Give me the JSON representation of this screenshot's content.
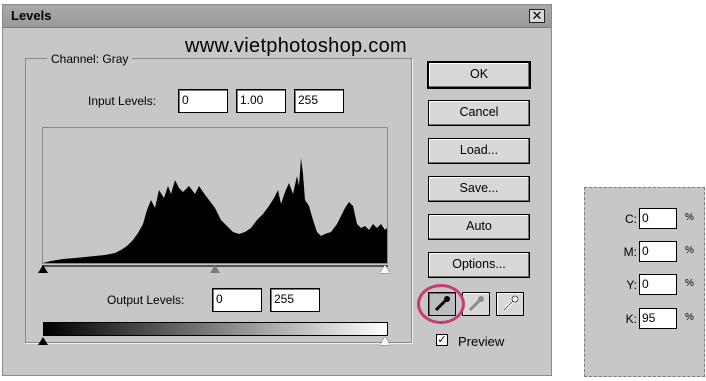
{
  "window": {
    "title": "Levels",
    "close_glyph": "✕"
  },
  "watermark": "www.vietphotoshop.com",
  "channel": {
    "label": "Channel:",
    "value": "Gray"
  },
  "input_levels": {
    "label": "Input Levels:",
    "black": "0",
    "gamma": "1.00",
    "white": "255"
  },
  "output_levels": {
    "label": "Output Levels:",
    "black": "0",
    "white": "255"
  },
  "buttons": {
    "ok": "OK",
    "cancel": "Cancel",
    "load": "Load...",
    "save": "Save...",
    "auto": "Auto",
    "options": "Options..."
  },
  "eyedroppers": [
    {
      "icon": "black-eyedropper-icon",
      "selected": true
    },
    {
      "icon": "gray-eyedropper-icon",
      "selected": false
    },
    {
      "icon": "white-eyedropper-icon",
      "selected": false
    }
  ],
  "preview": {
    "label": "Preview",
    "checked": true,
    "check_glyph": "✓"
  },
  "highlight_color": "#c93a78",
  "info_panel": {
    "rows": [
      {
        "key": "C:",
        "value": "0",
        "unit": "%"
      },
      {
        "key": "M:",
        "value": "0",
        "unit": "%"
      },
      {
        "key": "Y:",
        "value": "0",
        "unit": "%"
      },
      {
        "key": "K:",
        "value": "95",
        "unit": "%"
      }
    ]
  }
}
